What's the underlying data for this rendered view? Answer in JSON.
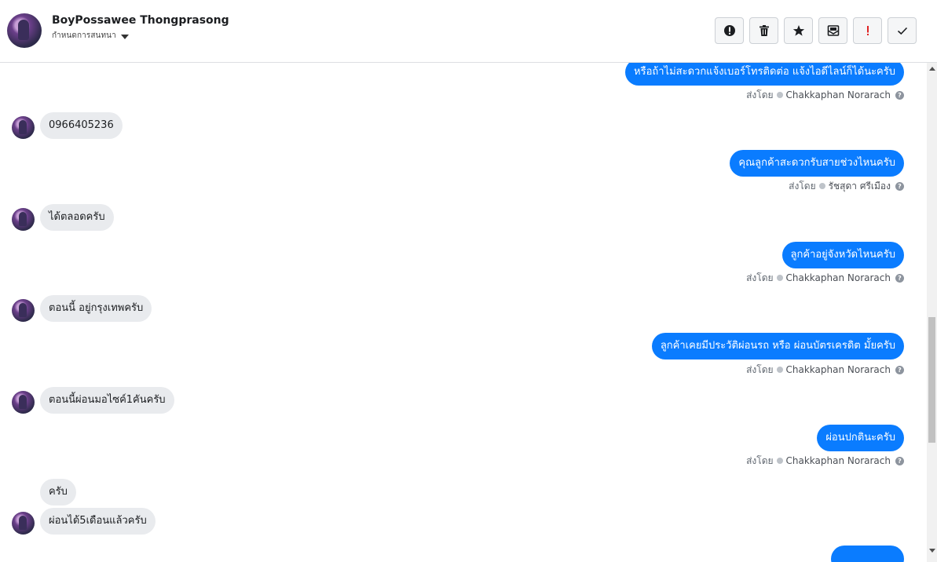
{
  "header": {
    "contact_name": "BoyPossawee Thongprasong",
    "subtitle": "กำหนดการสนทนา",
    "actions": [
      {
        "icon": "alert-circle-icon",
        "label": "Mark as spam"
      },
      {
        "icon": "trash-icon",
        "label": "Delete"
      },
      {
        "icon": "star-icon",
        "label": "Star"
      },
      {
        "icon": "mark-unread-icon",
        "label": "Mark as unread"
      },
      {
        "icon": "exclamation-icon",
        "label": "Follow up"
      },
      {
        "icon": "check-icon",
        "label": "Done"
      }
    ]
  },
  "messages": [
    {
      "direction": "out",
      "text": "หรือถ้าไม่สะดวกแจ้งเบอร์โทรติดต่อ แจ้งไอดีไลน์ก็ได้นะครับ",
      "sent_by_label": "ส่งโดย",
      "agent": "Chakkaphan Norarach"
    },
    {
      "direction": "in",
      "text": "0966405236"
    },
    {
      "direction": "out",
      "text": "คุณลูกค้าสะดวกรับสายช่วงไหนครับ",
      "sent_by_label": "ส่งโดย",
      "agent": "รัชสุดา ศรีเมือง"
    },
    {
      "direction": "in",
      "text": "ได้ตลอดครับ"
    },
    {
      "direction": "out",
      "text": "ลูกค้าอยู่จังหวัดไหนครับ",
      "sent_by_label": "ส่งโดย",
      "agent": "Chakkaphan Norarach"
    },
    {
      "direction": "in",
      "text": "ตอนนี้ อยู่กรุงเทพครับ"
    },
    {
      "direction": "out",
      "text": "ลูกค้าเคยมีประวัติผ่อนรถ หรือ ผ่อนบัตรเครดิต มั้ยครับ",
      "sent_by_label": "ส่งโดย",
      "agent": "Chakkaphan Norarach"
    },
    {
      "direction": "in",
      "text": "ตอนนี้ผ่อนมอไซค์1คันครับ"
    },
    {
      "direction": "out",
      "text": "ผ่อนปกตินะครับ",
      "sent_by_label": "ส่งโดย",
      "agent": "Chakkaphan Norarach"
    },
    {
      "direction": "in",
      "text": "ครับ"
    },
    {
      "direction": "in",
      "text": "ผ่อนได้5เดือนแล้วครับ"
    }
  ],
  "colors": {
    "outgoing_bubble": "#0a7cff",
    "incoming_bubble": "#e9ebee",
    "accent_red": "#e02424"
  }
}
